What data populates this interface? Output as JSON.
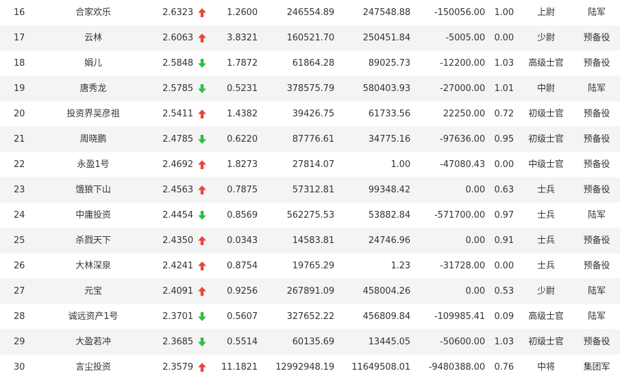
{
  "colors": {
    "up": "#e8453c",
    "down": "#2cbf3f",
    "text": "#333333",
    "stripe": "#f4f4f4"
  },
  "icons": {
    "up": "arrow-up-icon",
    "down": "arrow-down-icon"
  },
  "rows": [
    {
      "rank": "16",
      "name": "合家欢乐",
      "net": "2.6323",
      "trend": "up",
      "v1": "1.2600",
      "v2": "246554.89",
      "v3": "247548.88",
      "v4": "-150056.00",
      "v5": "1.00",
      "rank_title": "上尉",
      "army": "陆军"
    },
    {
      "rank": "17",
      "name": "云林",
      "net": "2.6063",
      "trend": "up",
      "v1": "3.8321",
      "v2": "160521.70",
      "v3": "250451.84",
      "v4": "-5005.00",
      "v5": "0.00",
      "rank_title": "少尉",
      "army": "预备役"
    },
    {
      "rank": "18",
      "name": "娟儿",
      "net": "2.5848",
      "trend": "down",
      "v1": "1.7872",
      "v2": "61864.28",
      "v3": "89025.73",
      "v4": "-12200.00",
      "v5": "1.03",
      "rank_title": "高级士官",
      "army": "预备役"
    },
    {
      "rank": "19",
      "name": "唐秀龙",
      "net": "2.5785",
      "trend": "down",
      "v1": "0.5231",
      "v2": "378575.79",
      "v3": "580403.93",
      "v4": "-27000.00",
      "v5": "1.01",
      "rank_title": "中尉",
      "army": "陆军"
    },
    {
      "rank": "20",
      "name": "投资界吴彦祖",
      "net": "2.5411",
      "trend": "up",
      "v1": "1.4382",
      "v2": "39426.75",
      "v3": "61733.56",
      "v4": "22250.00",
      "v5": "0.72",
      "rank_title": "初级士官",
      "army": "预备役"
    },
    {
      "rank": "21",
      "name": "周晓鹏",
      "net": "2.4785",
      "trend": "down",
      "v1": "0.6220",
      "v2": "87776.61",
      "v3": "34775.16",
      "v4": "-97636.00",
      "v5": "0.95",
      "rank_title": "初级士官",
      "army": "预备役"
    },
    {
      "rank": "22",
      "name": "永盈1号",
      "net": "2.4692",
      "trend": "up",
      "v1": "1.8273",
      "v2": "27814.07",
      "v3": "1.00",
      "v4": "-47080.43",
      "v5": "0.00",
      "rank_title": "中级士官",
      "army": "预备役"
    },
    {
      "rank": "23",
      "name": "饿狼下山",
      "net": "2.4563",
      "trend": "up",
      "v1": "0.7875",
      "v2": "57312.81",
      "v3": "99348.42",
      "v4": "0.00",
      "v5": "0.63",
      "rank_title": "士兵",
      "army": "预备役"
    },
    {
      "rank": "24",
      "name": "中庸投资",
      "net": "2.4454",
      "trend": "down",
      "v1": "0.8569",
      "v2": "562275.53",
      "v3": "53882.84",
      "v4": "-571700.00",
      "v5": "0.97",
      "rank_title": "士兵",
      "army": "陆军"
    },
    {
      "rank": "25",
      "name": "杀戮天下",
      "net": "2.4350",
      "trend": "up",
      "v1": "0.0343",
      "v2": "14583.81",
      "v3": "24746.96",
      "v4": "0.00",
      "v5": "0.91",
      "rank_title": "士兵",
      "army": "预备役"
    },
    {
      "rank": "26",
      "name": "大林深泉",
      "net": "2.4241",
      "trend": "up",
      "v1": "0.8754",
      "v2": "19765.29",
      "v3": "1.23",
      "v4": "-31728.00",
      "v5": "0.00",
      "rank_title": "士兵",
      "army": "预备役"
    },
    {
      "rank": "27",
      "name": "元宝",
      "net": "2.4091",
      "trend": "up",
      "v1": "0.9256",
      "v2": "267891.09",
      "v3": "458004.26",
      "v4": "0.00",
      "v5": "0.53",
      "rank_title": "少尉",
      "army": "陆军"
    },
    {
      "rank": "28",
      "name": "诚远资产1号",
      "net": "2.3701",
      "trend": "down",
      "v1": "0.5607",
      "v2": "327652.22",
      "v3": "456809.84",
      "v4": "-109985.41",
      "v5": "0.09",
      "rank_title": "高级士官",
      "army": "陆军"
    },
    {
      "rank": "29",
      "name": "大盈若冲",
      "net": "2.3685",
      "trend": "down",
      "v1": "0.5514",
      "v2": "60135.69",
      "v3": "13445.05",
      "v4": "-50600.00",
      "v5": "1.03",
      "rank_title": "初级士官",
      "army": "预备役"
    },
    {
      "rank": "30",
      "name": "言尘投资",
      "net": "2.3579",
      "trend": "up",
      "v1": "11.1821",
      "v2": "12992948.19",
      "v3": "11649508.01",
      "v4": "-9480388.00",
      "v5": "0.76",
      "rank_title": "中将",
      "army": "集团军"
    }
  ]
}
